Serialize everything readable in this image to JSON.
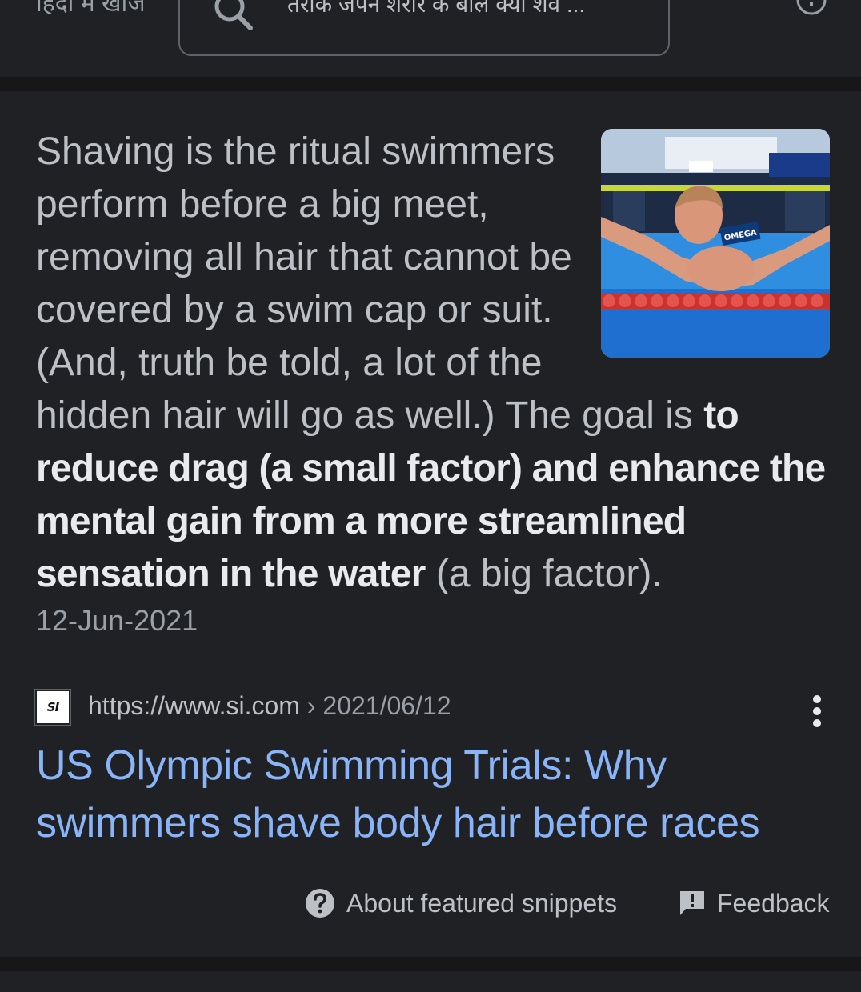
{
  "topbar": {
    "hindi_search_label": "हिंदी में खोजें",
    "query": "तैराक जेपन शरीर के बाल क्यों शेव ..."
  },
  "snippet": {
    "text_before_bold": "Shaving is the ritual swimmers perform before a big meet, removing all hair that cannot be covered by a swim cap or suit. (And, truth be told, a lot of the hidden hair will go as well.) The goal is ",
    "text_bold": "to reduce drag (a small factor) and enhance the mental gain from a more streamlined sensation in the water",
    "text_after_bold": " (a big factor).",
    "date": "12-Jun-2021",
    "thumbnail_logo_text": "OMEGA"
  },
  "source": {
    "favicon_text": "SI",
    "url": "https://www.si.com",
    "path": " › 2021/06/12"
  },
  "result": {
    "title": "US Olympic Swimming Trials: Why swimmers shave body hair before races"
  },
  "footer": {
    "about_label": "About featured snippets",
    "feedback_label": "Feedback"
  },
  "colors": {
    "background": "#202124",
    "separator": "#171717",
    "text": "#bdc1c6",
    "text_strong": "#e8eaed",
    "text_muted": "#9aa0a6",
    "link": "#8ab4f8"
  }
}
